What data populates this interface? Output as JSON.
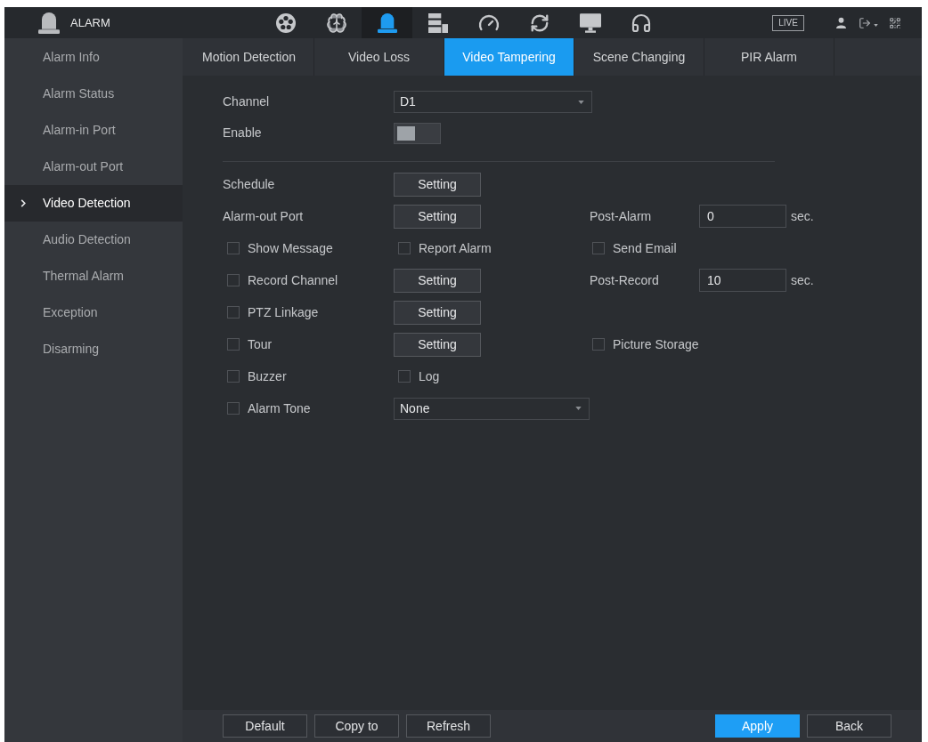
{
  "header": {
    "title": "ALARM",
    "live_label": "LIVE"
  },
  "header_icons": [
    {
      "kind": "reel",
      "selected": false
    },
    {
      "kind": "brain",
      "selected": false
    },
    {
      "kind": "bell",
      "selected": true
    },
    {
      "kind": "storage",
      "selected": false
    },
    {
      "kind": "gauge",
      "selected": false
    },
    {
      "kind": "sync",
      "selected": false
    },
    {
      "kind": "monitor",
      "selected": false
    },
    {
      "kind": "headset",
      "selected": false
    }
  ],
  "sidebar": {
    "items": [
      {
        "label": "Alarm Info",
        "selected": false
      },
      {
        "label": "Alarm Status",
        "selected": false
      },
      {
        "label": "Alarm-in Port",
        "selected": false
      },
      {
        "label": "Alarm-out Port",
        "selected": false
      },
      {
        "label": "Video Detection",
        "selected": true
      },
      {
        "label": "Audio Detection",
        "selected": false
      },
      {
        "label": "Thermal Alarm",
        "selected": false
      },
      {
        "label": "Exception",
        "selected": false
      },
      {
        "label": "Disarming",
        "selected": false
      }
    ]
  },
  "tabs": [
    {
      "label": "Motion Detection",
      "selected": false
    },
    {
      "label": "Video Loss",
      "selected": false
    },
    {
      "label": "Video Tampering",
      "selected": true
    },
    {
      "label": "Scene Changing",
      "selected": false
    },
    {
      "label": "PIR Alarm",
      "selected": false
    }
  ],
  "form": {
    "channel": {
      "label": "Channel",
      "value": "D1"
    },
    "enable": {
      "label": "Enable",
      "on": false
    },
    "rows": [
      {
        "left": {
          "kind": "label",
          "label": "Schedule"
        },
        "middle": {
          "kind": "button",
          "label": "Setting"
        }
      },
      {
        "left": {
          "kind": "label",
          "label": "Alarm-out Port"
        },
        "middle": {
          "kind": "button",
          "label": "Setting"
        },
        "right": {
          "kind": "field",
          "label": "Post-Alarm",
          "value": "0",
          "unit": "sec."
        }
      },
      {
        "left": {
          "kind": "checkbox",
          "label": "Show Message",
          "checked": false
        },
        "middle": {
          "kind": "checkbox",
          "label": "Report Alarm",
          "checked": false
        },
        "right": {
          "kind": "checkbox",
          "label": "Send Email",
          "checked": false
        }
      },
      {
        "left": {
          "kind": "checkbox",
          "label": "Record Channel",
          "checked": false
        },
        "middle": {
          "kind": "button",
          "label": "Setting"
        },
        "right": {
          "kind": "field",
          "label": "Post-Record",
          "value": "10",
          "unit": "sec."
        }
      },
      {
        "left": {
          "kind": "checkbox",
          "label": "PTZ Linkage",
          "checked": false
        },
        "middle": {
          "kind": "button",
          "label": "Setting"
        }
      },
      {
        "left": {
          "kind": "checkbox",
          "label": "Tour",
          "checked": false
        },
        "middle": {
          "kind": "button",
          "label": "Setting"
        },
        "right": {
          "kind": "checkbox",
          "label": "Picture Storage",
          "checked": false
        }
      },
      {
        "left": {
          "kind": "checkbox",
          "label": "Buzzer",
          "checked": false
        },
        "middle": {
          "kind": "checkbox",
          "label": "Log",
          "checked": false
        }
      },
      {
        "left": {
          "kind": "checkbox",
          "label": "Alarm Tone",
          "checked": false
        },
        "middle": {
          "kind": "select",
          "value": "None"
        }
      }
    ]
  },
  "footer": {
    "left_buttons": [
      {
        "label": "Default",
        "primary": false
      },
      {
        "label": "Copy to",
        "primary": false
      },
      {
        "label": "Refresh",
        "primary": false
      }
    ],
    "right_buttons": [
      {
        "label": "Apply",
        "primary": true
      },
      {
        "label": "Back",
        "primary": false
      }
    ]
  }
}
